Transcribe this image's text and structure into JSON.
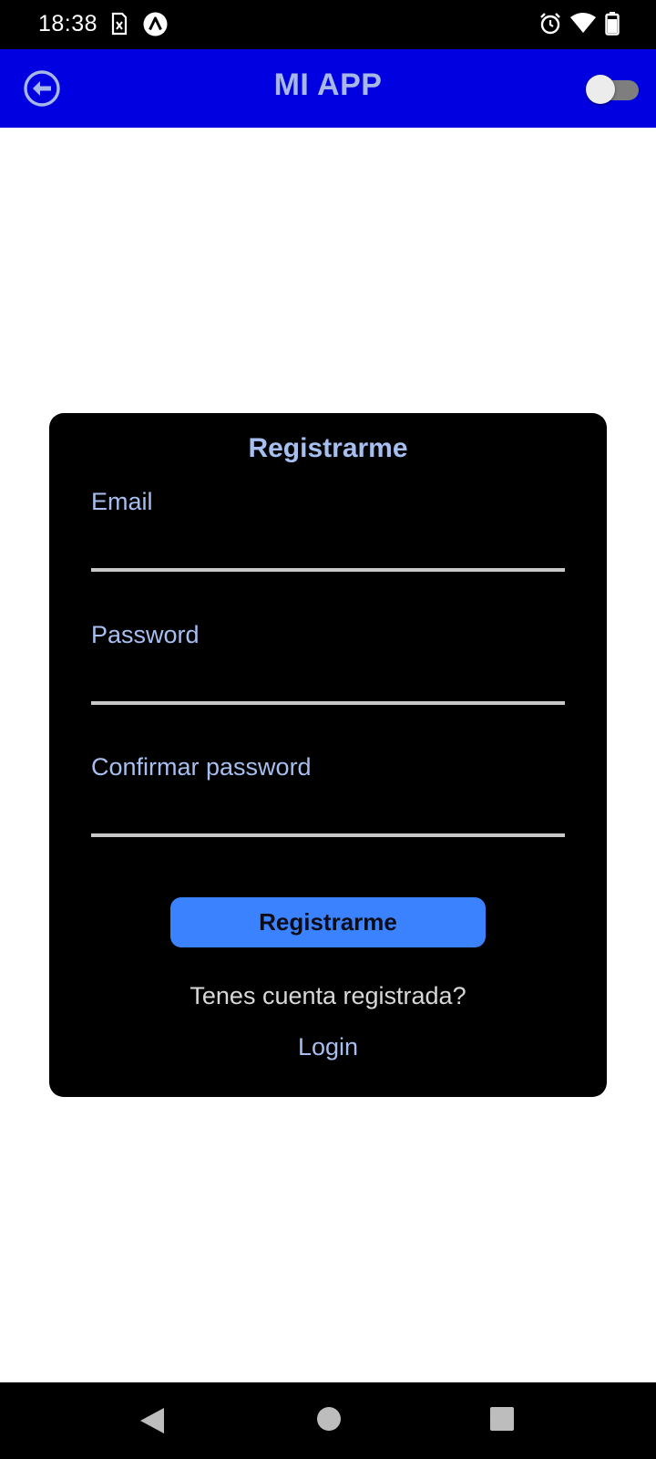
{
  "status_bar": {
    "time": "18:38"
  },
  "app_bar": {
    "title": "MI APP",
    "toggle_on": false
  },
  "form": {
    "title": "Registrarme",
    "fields": [
      {
        "label": "Email",
        "value": ""
      },
      {
        "label": "Password",
        "value": ""
      },
      {
        "label": "Confirmar password",
        "value": ""
      }
    ],
    "submit_label": "Registrarme",
    "account_question": "Tenes cuenta registrada?",
    "login_link": "Login"
  },
  "colors": {
    "app_bar": "#0000e0",
    "accent_button": "#3b82ff",
    "label_text": "#a7bff0",
    "card": "#000000"
  }
}
